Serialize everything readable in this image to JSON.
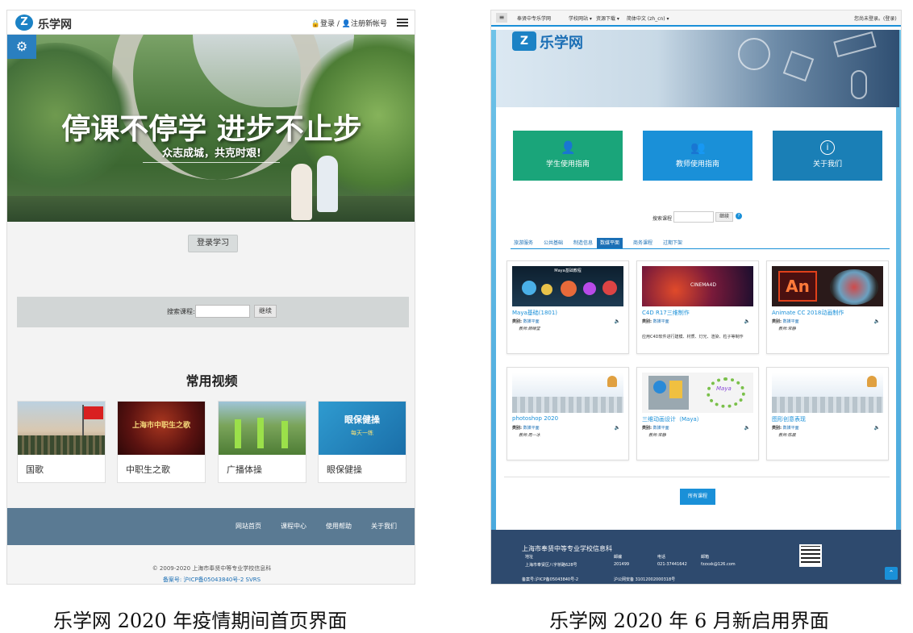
{
  "left": {
    "brand": "乐学网",
    "logo_glyph": "Z",
    "auth_text": "🔒登录 / 👤注册新帐号",
    "hero_title": "停课不停学 进步不止步",
    "hero_subtitle": "众志成城，共克时艰!",
    "login_button": "登录学习",
    "search_label": "搜索课程:",
    "search_button": "继续",
    "videos_title": "常用视频",
    "videos": [
      {
        "label": "国歌"
      },
      {
        "label": "中职生之歌",
        "thumb_text": "上海市中职生之歌"
      },
      {
        "label": "广播体操"
      },
      {
        "label": "眼保健操",
        "thumb_text": "眼保健操",
        "thumb_text2": "每天一练"
      }
    ],
    "footer_links": [
      "网站首页",
      "课程中心",
      "使用帮助",
      "关于我们"
    ],
    "copyright": "© 2009-2020 上海市奉贤中等专业学校信息科",
    "icp": "备案号: 沪ICP备05043840号-2 SVRS"
  },
  "right": {
    "topbar": {
      "school": "奉贤中专乐学网",
      "menu1": "学校网站 ▾",
      "menu2": "资源下载 ▾",
      "menu3": "简体中文 (zh_cn) ▾",
      "login_note": "您尚未登录。(登录)"
    },
    "brand": "乐学网",
    "logo_glyph": "Z",
    "guides": [
      {
        "label": "学生使用指南",
        "icon": "person-icon",
        "color": "#1aa57a"
      },
      {
        "label": "教师使用指南",
        "icon": "teacher-icon",
        "color": "#1a90d8"
      },
      {
        "label": "关于我们",
        "icon": "info-icon",
        "color": "#1a7fb6"
      }
    ],
    "search_label": "搜索课程",
    "search_button": "继续",
    "tabs": [
      "旅游服务",
      "公共基础",
      "制造信息",
      "数媒平面",
      "商务课程",
      "过期下架"
    ],
    "active_tab": 3,
    "courses": [
      {
        "title": "Maya基础(1801)",
        "category_label": "类别:",
        "category": "数媒平面",
        "teacher": "教师:顾继堂",
        "thumb_text": "Maya基础教程"
      },
      {
        "title": "C4D R17三维制作",
        "category_label": "类别:",
        "category": "数媒平面",
        "teacher": "",
        "desc": "应用C4D软件进行建模、材质、灯光、渲染、粒子等制作",
        "thumb_text": "CINEMA4D"
      },
      {
        "title": "Animate CC 2018动画制作",
        "category_label": "类别:",
        "category": "数媒平面",
        "teacher": "教师:宋静",
        "thumb_text": "An"
      },
      {
        "title": "photoshop 2020",
        "category_label": "类别:",
        "category": "数媒平面",
        "teacher": "教师:周一冰"
      },
      {
        "title": "三维动画设计（Maya）",
        "category_label": "类别:",
        "category": "数媒平面",
        "teacher": "教师:宋静",
        "thumb_text": "Maya"
      },
      {
        "title": "图形创意表现",
        "category_label": "类别:",
        "category": "数媒平面",
        "teacher": "教师:陈晨"
      }
    ],
    "all_courses_button": "所有课程",
    "footer": {
      "school": "上海市奉贤中等专业学校信息科",
      "addr_label": "地址",
      "addr": "上海市奉贤区八字桥路628号",
      "zip_label": "邮编",
      "zip": "201499",
      "phone_label": "电话",
      "phone": "021-37441642",
      "email_label": "邮箱",
      "email": "fzzxxk@126.com",
      "icp": "备案号:沪ICP备05043840号-2",
      "police": "沪公网安备 31012002000318号"
    }
  },
  "captions": {
    "left": "乐学网 2020 年疫情期间首页界面",
    "right": "乐学网 2020 年 6 月新启用界面"
  }
}
